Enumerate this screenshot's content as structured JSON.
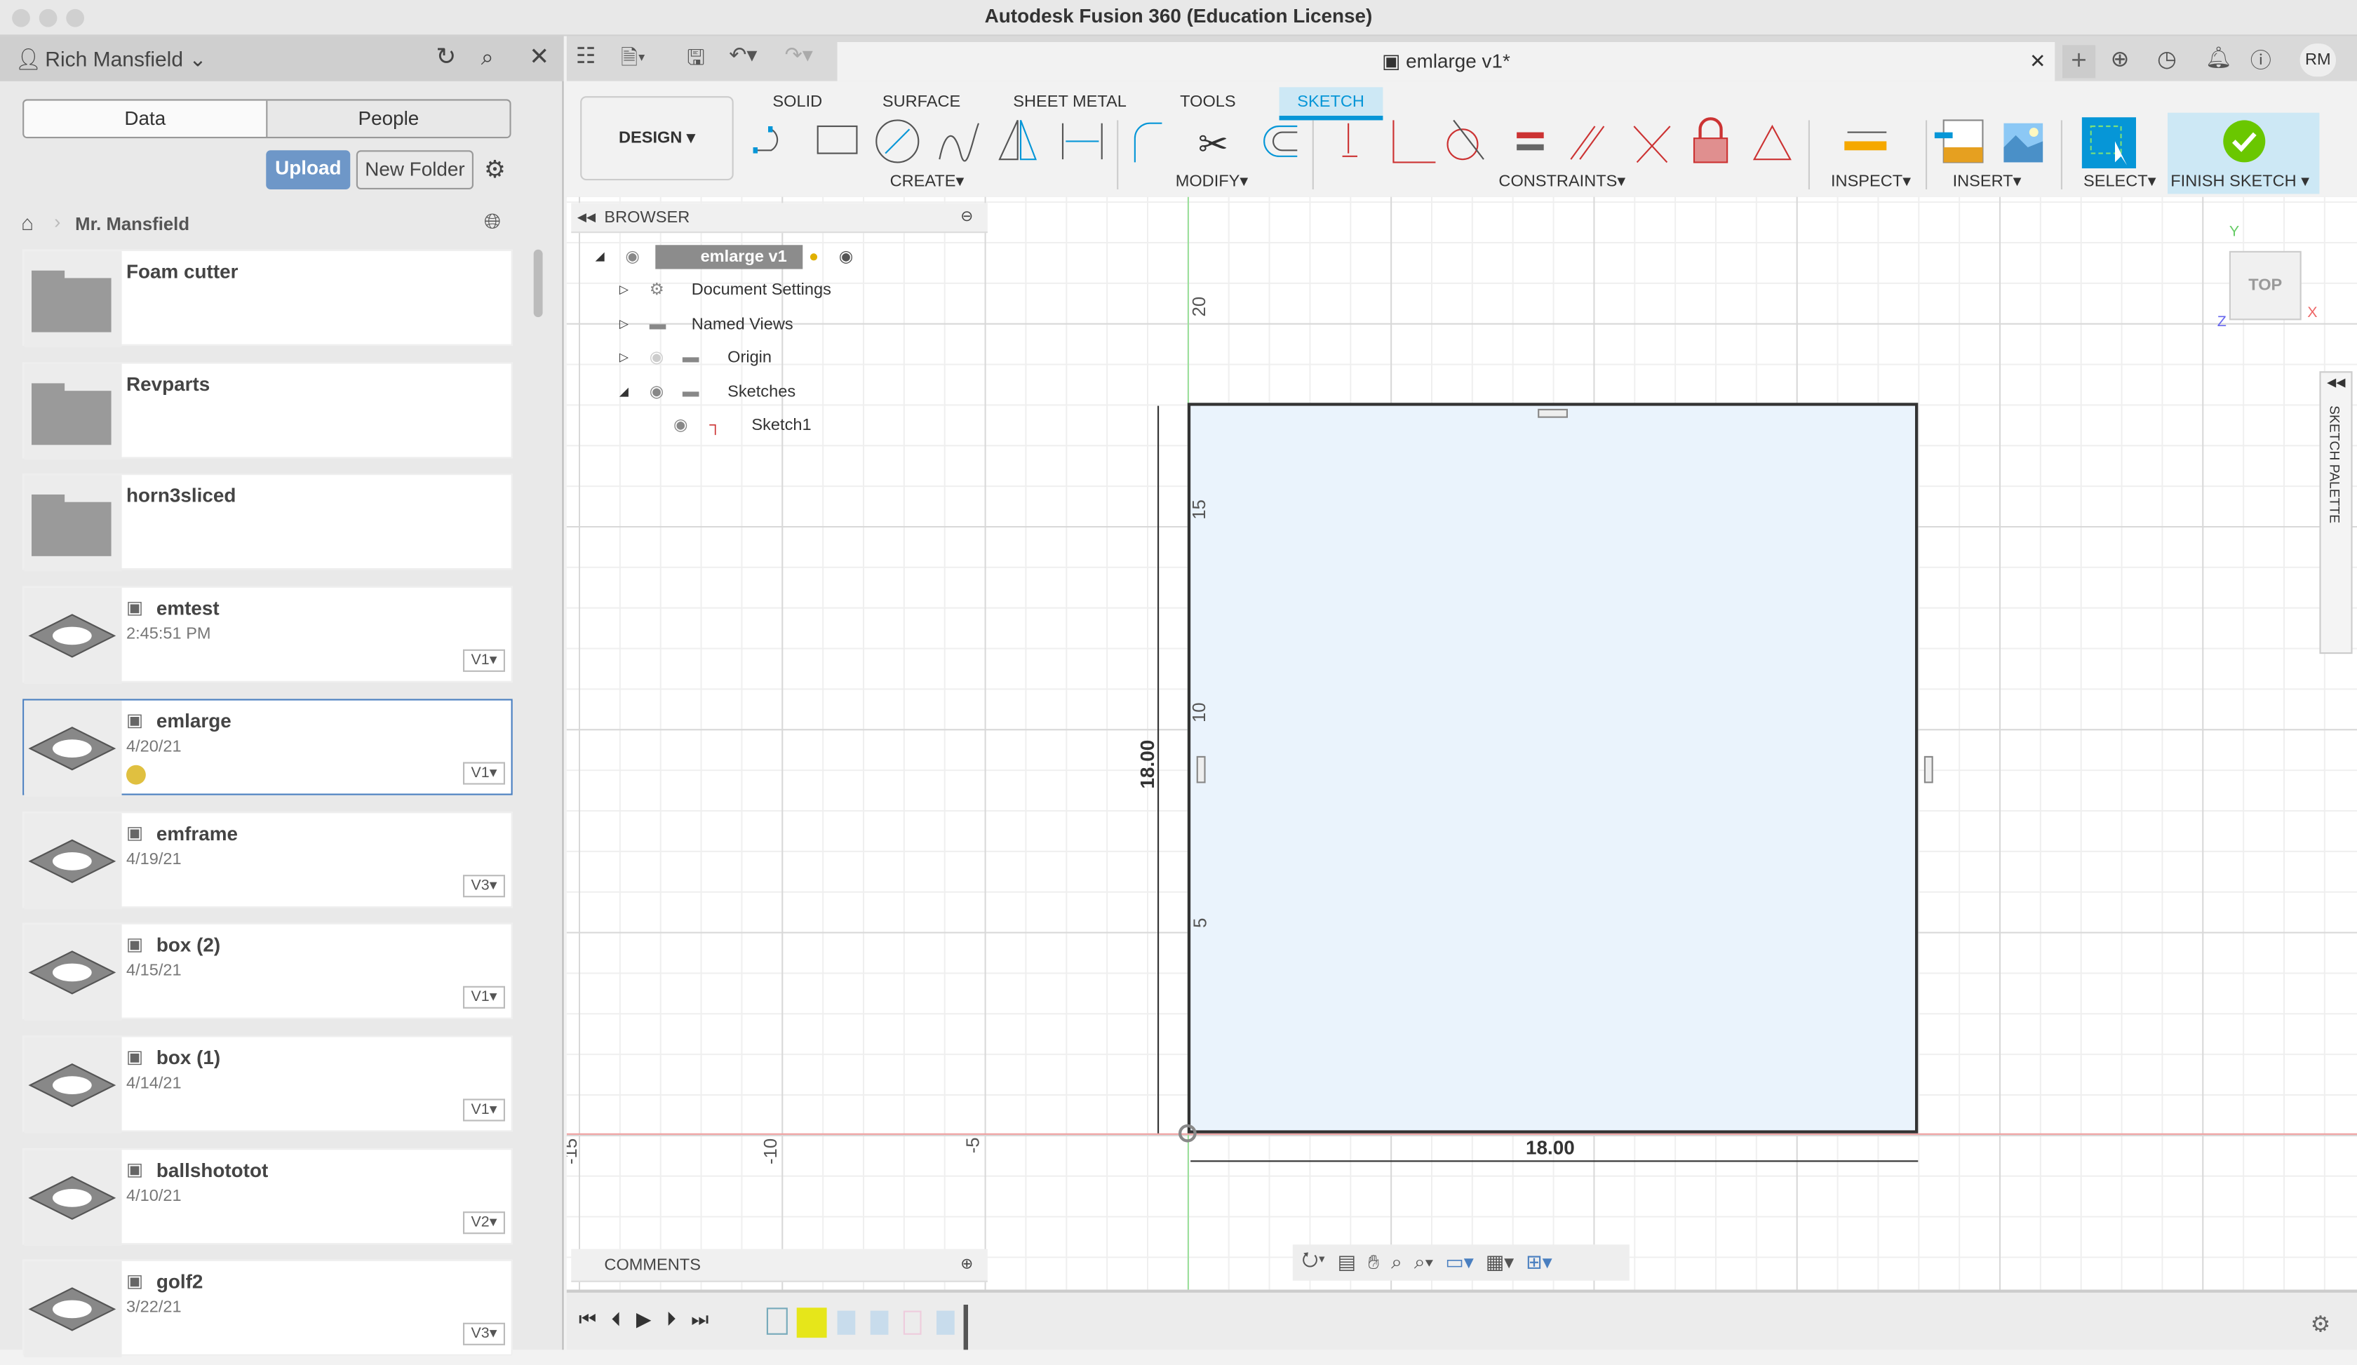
{
  "window": {
    "title": "Autodesk Fusion 360 (Education License)"
  },
  "data_panel": {
    "user": "Rich Mansfield",
    "tabs": [
      "Data",
      "People"
    ],
    "upload": "Upload",
    "new_folder": "New Folder",
    "breadcrumb": "Mr. Mansfield",
    "items": [
      {
        "name": "Foam cutter",
        "type": "folder",
        "date": "",
        "version": ""
      },
      {
        "name": "Revparts",
        "type": "folder",
        "date": "",
        "version": ""
      },
      {
        "name": "horn3sliced",
        "type": "folder",
        "date": "",
        "version": ""
      },
      {
        "name": "emtest",
        "type": "design",
        "date": "2:45:51 PM",
        "version": "V1"
      },
      {
        "name": "emlarge",
        "type": "design",
        "date": "4/20/21",
        "version": "V1",
        "selected": true
      },
      {
        "name": "emframe",
        "type": "design",
        "date": "4/19/21",
        "version": "V3"
      },
      {
        "name": "box (2)",
        "type": "design",
        "date": "4/15/21",
        "version": "V1"
      },
      {
        "name": "box (1)",
        "type": "design",
        "date": "4/14/21",
        "version": "V1"
      },
      {
        "name": "ballshototot",
        "type": "design",
        "date": "4/10/21",
        "version": "V2"
      },
      {
        "name": "golf2",
        "type": "design",
        "date": "3/22/21",
        "version": "V3"
      }
    ]
  },
  "document": {
    "tab_title": "emlarge v1*",
    "user_initials": "RM"
  },
  "ribbon": {
    "workspace": "DESIGN",
    "tabs": [
      "SOLID",
      "SURFACE",
      "SHEET METAL",
      "TOOLS",
      "SKETCH"
    ],
    "active_tab": "SKETCH",
    "groups": [
      "CREATE",
      "MODIFY",
      "CONSTRAINTS",
      "INSPECT",
      "INSERT",
      "SELECT",
      "FINISH SKETCH"
    ]
  },
  "browser": {
    "title": "BROWSER",
    "nodes": [
      "emlarge v1",
      "Document Settings",
      "Named Views",
      "Origin",
      "Sketches",
      "Sketch1"
    ]
  },
  "canvas": {
    "view_cube": "TOP",
    "axes": {
      "x": "X",
      "y": "Y",
      "z": "Z"
    },
    "ruler_y": [
      "20",
      "15",
      "10",
      "5"
    ],
    "ruler_x": [
      "-15",
      "-10",
      "-5"
    ],
    "dim_width": "18.00",
    "dim_height": "18.00",
    "sketch_palette": "SKETCH PALETTE"
  },
  "comments": {
    "title": "COMMENTS"
  },
  "colors": {
    "accent": "#0696d7",
    "sketch_fill": "#eaf3fc",
    "finish": "#6ac700"
  }
}
